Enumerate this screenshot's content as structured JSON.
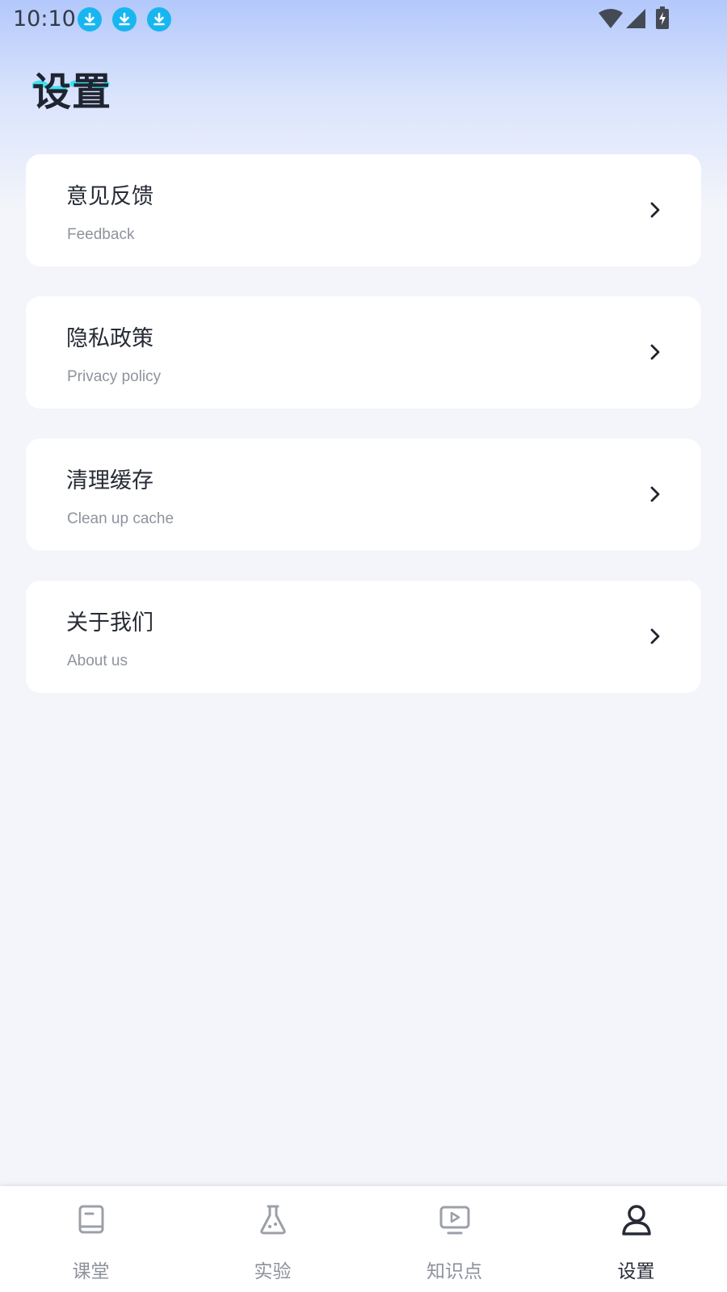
{
  "status_bar": {
    "time": "10:10",
    "notification_icons": [
      "download-icon",
      "download-icon",
      "download-icon"
    ],
    "system_icons": [
      "wifi-icon",
      "signal-icon",
      "battery-charging-icon"
    ]
  },
  "header": {
    "title": "设置",
    "accent_color": "#3ee0f0"
  },
  "menu": {
    "items": [
      {
        "title": "意见反馈",
        "subtitle": "Feedback",
        "icon": "chevron-right-icon"
      },
      {
        "title": "隐私政策",
        "subtitle": "Privacy policy",
        "icon": "chevron-right-icon"
      },
      {
        "title": "清理缓存",
        "subtitle": "Clean up cache",
        "icon": "chevron-right-icon"
      },
      {
        "title": "关于我们",
        "subtitle": "About us",
        "icon": "chevron-right-icon"
      }
    ]
  },
  "bottom_nav": {
    "active_index": 3,
    "items": [
      {
        "label": "课堂",
        "icon": "book-icon"
      },
      {
        "label": "实验",
        "icon": "flask-icon"
      },
      {
        "label": "知识点",
        "icon": "video-icon"
      },
      {
        "label": "设置",
        "icon": "user-icon"
      }
    ]
  },
  "colors": {
    "background": "#f3f5fa",
    "gradient_top": "#b3c8fb",
    "card": "#ffffff",
    "title_text": "#262b35",
    "subtitle_text": "#8e939c",
    "download_badge": "#18b6f0",
    "nav_inactive": "#8d929a",
    "nav_active": "#262b35"
  }
}
